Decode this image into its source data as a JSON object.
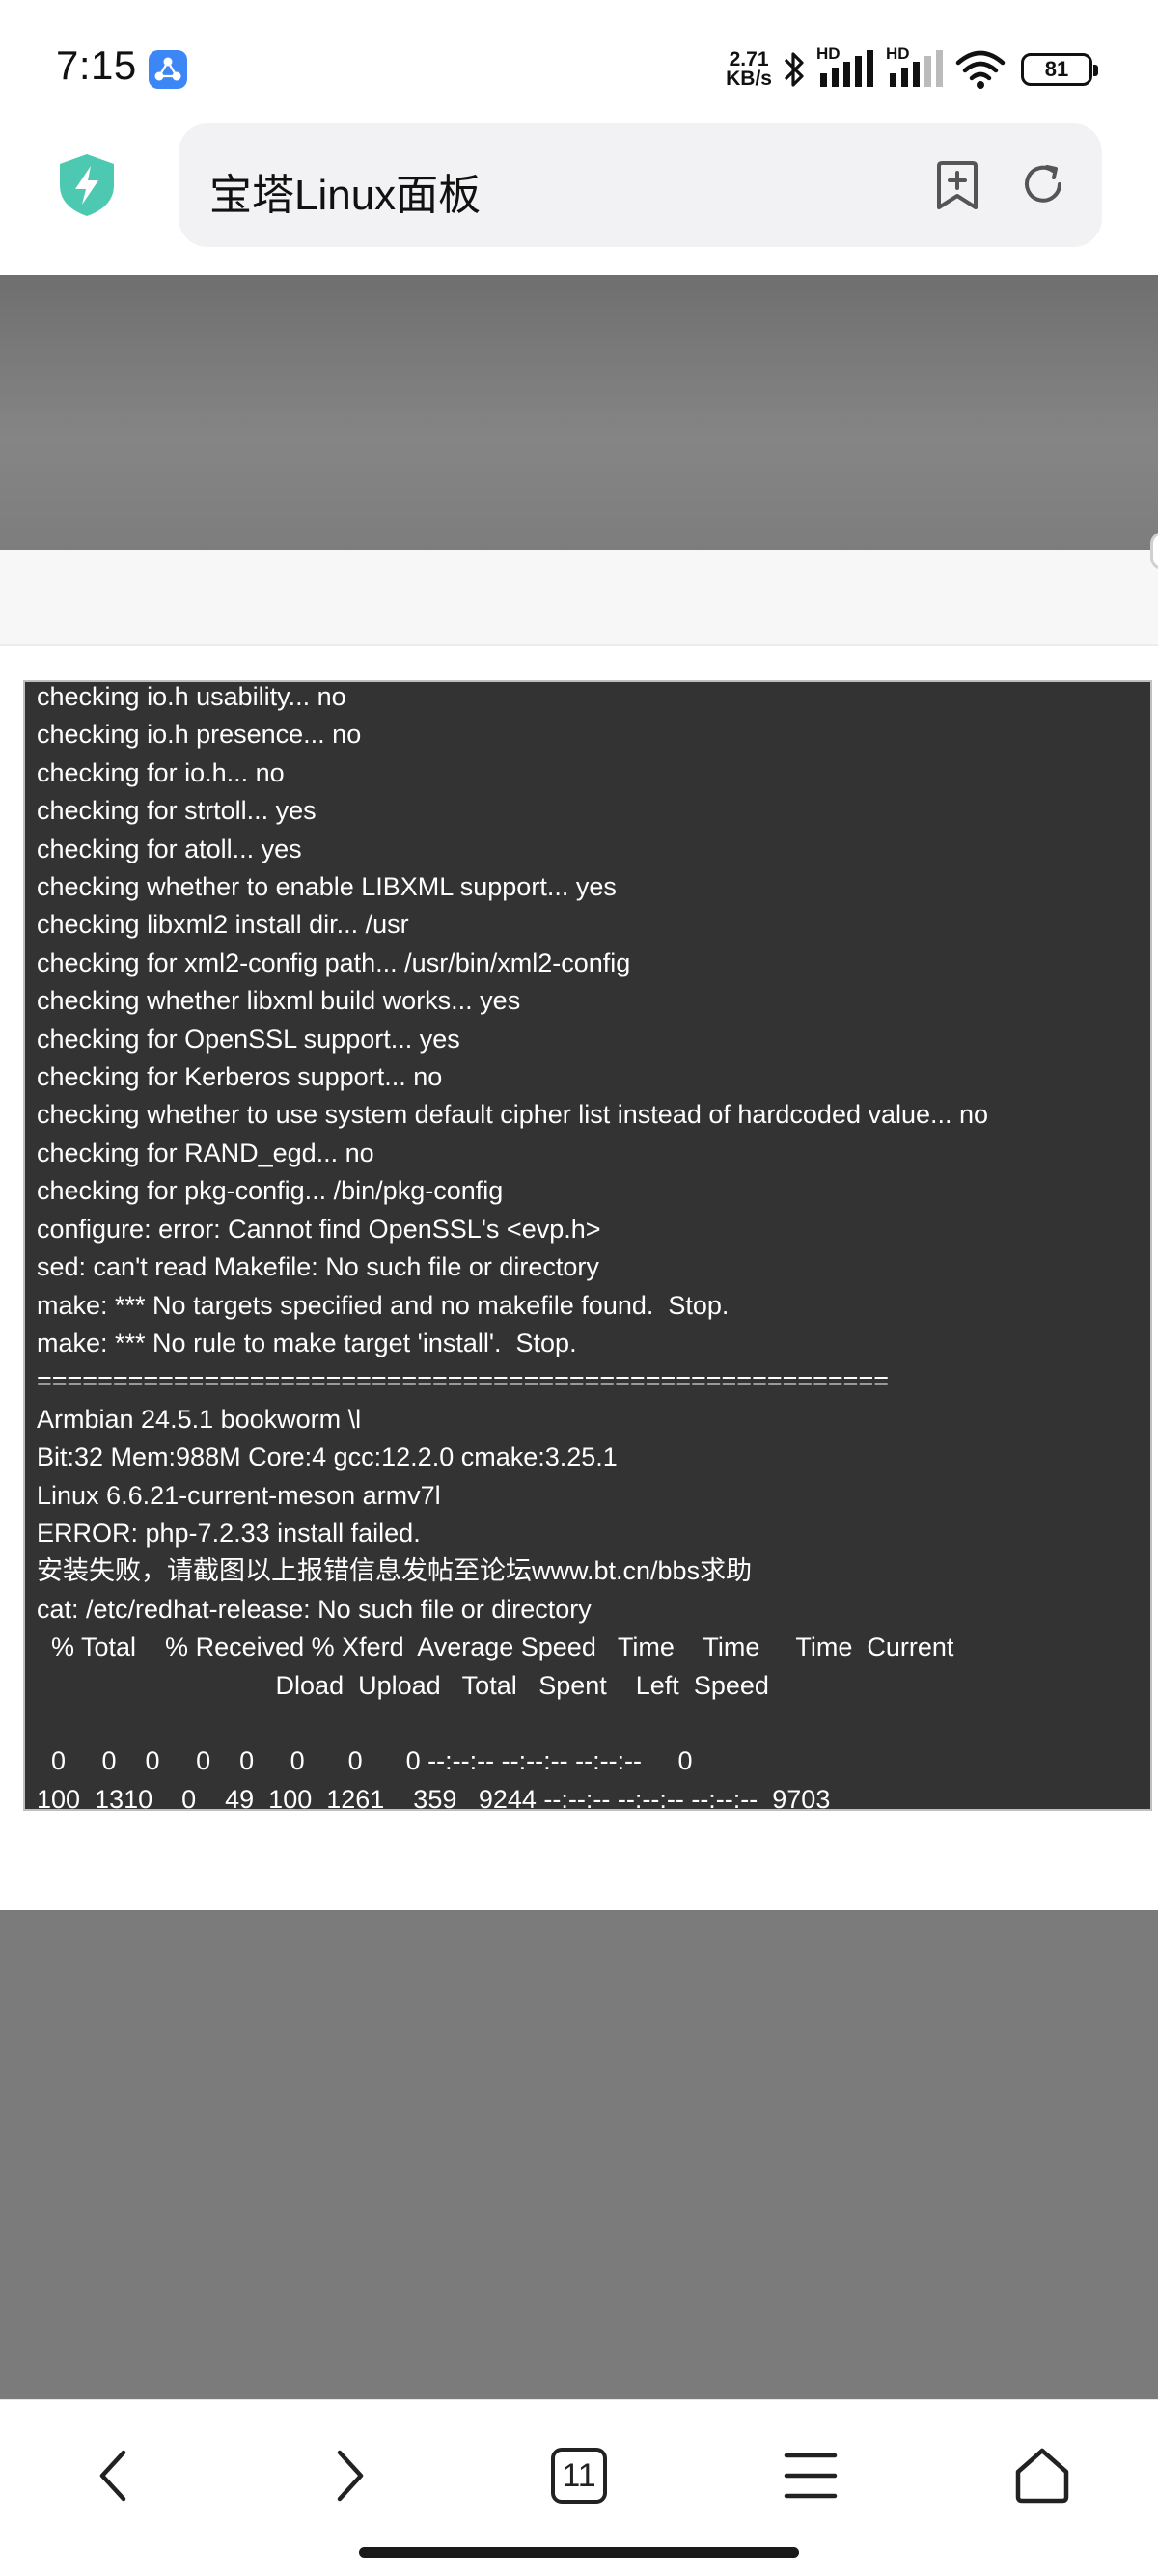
{
  "status_bar": {
    "time": "7:15",
    "net_speed_value": "2.71",
    "net_speed_unit": "KB/s",
    "signal_1_label": "HD",
    "signal_2_label": "HD",
    "battery_level": "81",
    "icons": [
      "app-notification-icon",
      "bluetooth-icon",
      "signal-icon",
      "signal-icon",
      "wifi-icon",
      "battery-icon"
    ]
  },
  "address_bar": {
    "title": "宝塔Linux面板",
    "icons": [
      "shield-bolt-icon",
      "add-bookmark-icon",
      "refresh-icon"
    ]
  },
  "terminal": {
    "lines": [
      "checking io.h usability... no",
      "checking io.h presence... no",
      "checking for io.h... no",
      "checking for strtoll... yes",
      "checking for atoll... yes",
      "checking whether to enable LIBXML support... yes",
      "checking libxml2 install dir... /usr",
      "checking for xml2-config path... /usr/bin/xml2-config",
      "checking whether libxml build works... yes",
      "checking for OpenSSL support... yes",
      "checking for Kerberos support... no",
      "checking whether to use system default cipher list instead of hardcoded value... no",
      "checking for RAND_egd... no",
      "checking for pkg-config... /bin/pkg-config",
      "configure: error: Cannot find OpenSSL's <evp.h>",
      "sed: can't read Makefile: No such file or directory",
      "make: *** No targets specified and no makefile found.  Stop.",
      "make: *** No rule to make target 'install'.  Stop.",
      "========================================================",
      "Armbian 24.5.1 bookworm \\l",
      "Bit:32 Mem:988M Core:4 gcc:12.2.0 cmake:3.25.1",
      "Linux 6.6.21-current-meson armv7l",
      "ERROR: php-7.2.33 install failed.",
      "安装失败，请截图以上报错信息发帖至论坛www.bt.cn/bbs求助",
      "cat: /etc/redhat-release: No such file or directory",
      "  % Total    % Received % Xferd  Average Speed   Time    Time     Time  Current",
      "                                 Dload  Upload   Total   Spent    Left  Speed",
      "",
      "  0     0    0     0    0     0      0      0 --:--:-- --:--:-- --:--:--     0",
      "100  1310    0    49  100  1261    359   9244 --:--:-- --:--:-- --:--:--  9703"
    ]
  },
  "bottom_nav": {
    "tabs_count": "11",
    "icons": [
      "back-icon",
      "forward-icon",
      "tabs-icon",
      "menu-icon",
      "home-icon"
    ]
  },
  "colors": {
    "terminal_bg": "#333333",
    "terminal_text": "#ffffff",
    "overlay": "#7b7b7b",
    "shield_accent": "#4cc9b0"
  }
}
